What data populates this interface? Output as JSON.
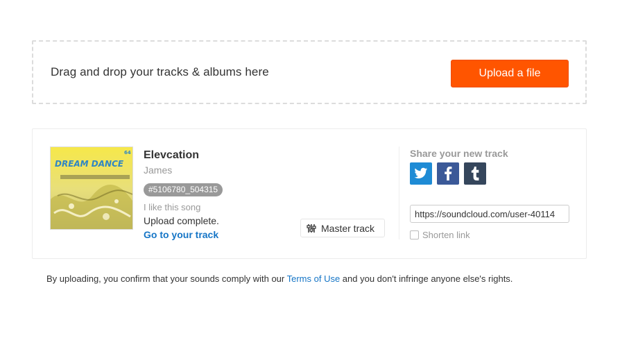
{
  "dropzone": {
    "text": "Drag and drop your tracks & albums here",
    "upload_label": "Upload a file"
  },
  "track": {
    "title": "Elevcation",
    "artist": "James",
    "tag": "#5106780_504315",
    "description": "I like this song",
    "status": "Upload complete.",
    "link_label": "Go to your track",
    "master_label": "Master track",
    "artwork_text": "DREAM DANCE",
    "artwork_number": "64"
  },
  "share": {
    "title": "Share your new track",
    "icons": [
      "twitter-icon",
      "facebook-icon",
      "tumblr-icon"
    ],
    "url_value": "https://soundcloud.com/user-40114",
    "shorten_label": "Shorten link",
    "shorten_checked": false
  },
  "footer": {
    "before": "By uploading, you confirm that your sounds comply with our ",
    "link": "Terms of Use",
    "after": " and you don't infringe anyone else's rights."
  },
  "colors": {
    "accent": "#ff5500",
    "link": "#1575c6",
    "twitter": "#1e8bd5",
    "facebook": "#3b5998",
    "tumblr": "#35465c"
  }
}
